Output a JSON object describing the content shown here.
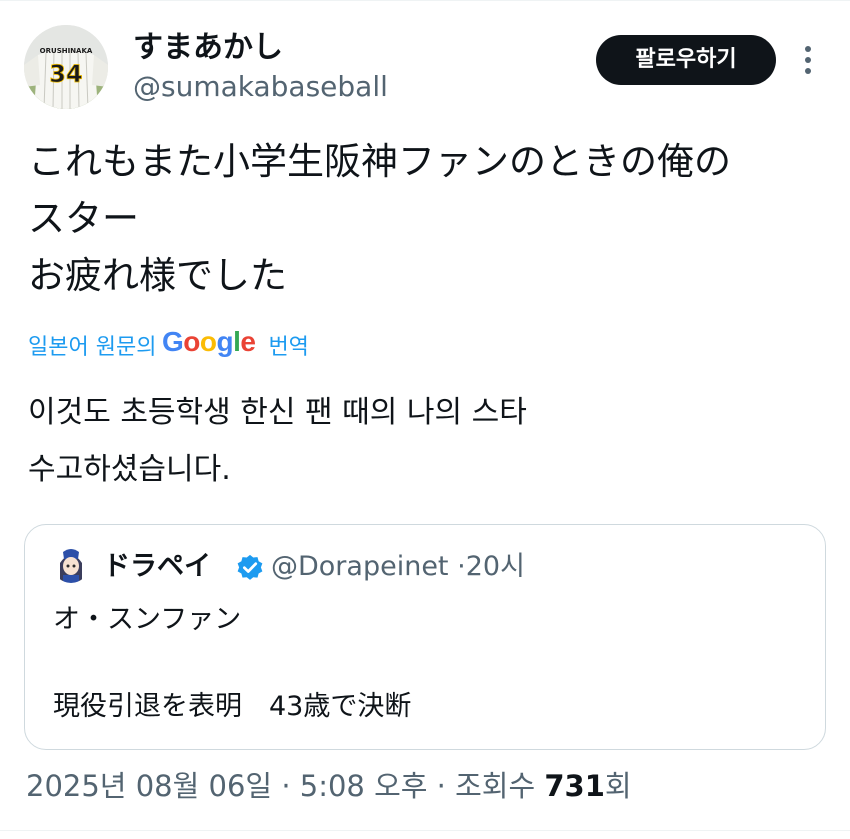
{
  "author": {
    "display_name": "すまあかし",
    "handle": "@sumakabaseball",
    "avatar_icon": "baseball-player-jersey-avatar",
    "jersey_name": "ORUSHINAKA",
    "jersey_number": "34"
  },
  "actions": {
    "follow_label": "팔로우하기",
    "more_icon": "vertical-ellipsis-icon"
  },
  "tweet": {
    "lines": [
      "これもまた小学生阪神ファンのときの俺の",
      "スター",
      "お疲れ様でした"
    ]
  },
  "translation": {
    "prefix": "일본어 원문의",
    "provider": "Google",
    "suffix": "번역",
    "lines": [
      "이것도 초등학생 한신 팬 때의 나의 스타",
      "수고하셨습니다."
    ]
  },
  "quote": {
    "display_name": "ドラペイ",
    "verified_icon": "verified-badge-icon",
    "handle": "@Dorapeinet",
    "separator": "·",
    "time": "20시",
    "line1": "オ・スンファン",
    "line2": "現役引退を表明　43歳で決断"
  },
  "meta": {
    "date": "2025년 08월 06일",
    "sep1": "·",
    "time": "5:08 오후",
    "sep2": "·",
    "views_label": "조회수",
    "views_count": "731",
    "views_unit": "회"
  },
  "colors": {
    "text": "#0f1419",
    "secondary": "#536471",
    "link_blue": "#1d9bf0",
    "verified": "#1d9bf0",
    "border": "#cfd9de"
  }
}
